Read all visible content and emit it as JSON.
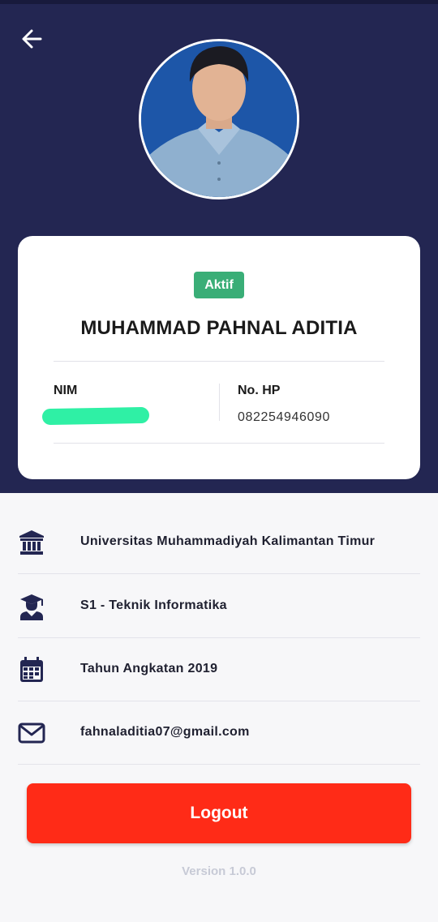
{
  "header": {
    "back_icon": "arrow-left-icon",
    "avatar_alt": "profile photo"
  },
  "profile": {
    "status": "Aktif",
    "name": "MUHAMMAD PAHNAL ADITIA",
    "nim_label": "NIM",
    "nim_value": "",
    "phone_label": "No. HP",
    "phone_value": "082254946090"
  },
  "details": [
    {
      "icon": "university-icon",
      "text": "Universitas Muhammadiyah Kalimantan Timur"
    },
    {
      "icon": "graduate-icon",
      "text": "S1 - Teknik Informatika"
    },
    {
      "icon": "calendar-icon",
      "text": "Tahun Angkatan 2019"
    },
    {
      "icon": "mail-icon",
      "text": "fahnaladitia07@gmail.com"
    }
  ],
  "actions": {
    "logout_label": "Logout"
  },
  "footer": {
    "version": "Version 1.0.0"
  },
  "colors": {
    "header_bg": "#232652",
    "badge_bg": "#3aae77",
    "logout_bg": "#ff2b17",
    "icon_color": "#232652"
  }
}
